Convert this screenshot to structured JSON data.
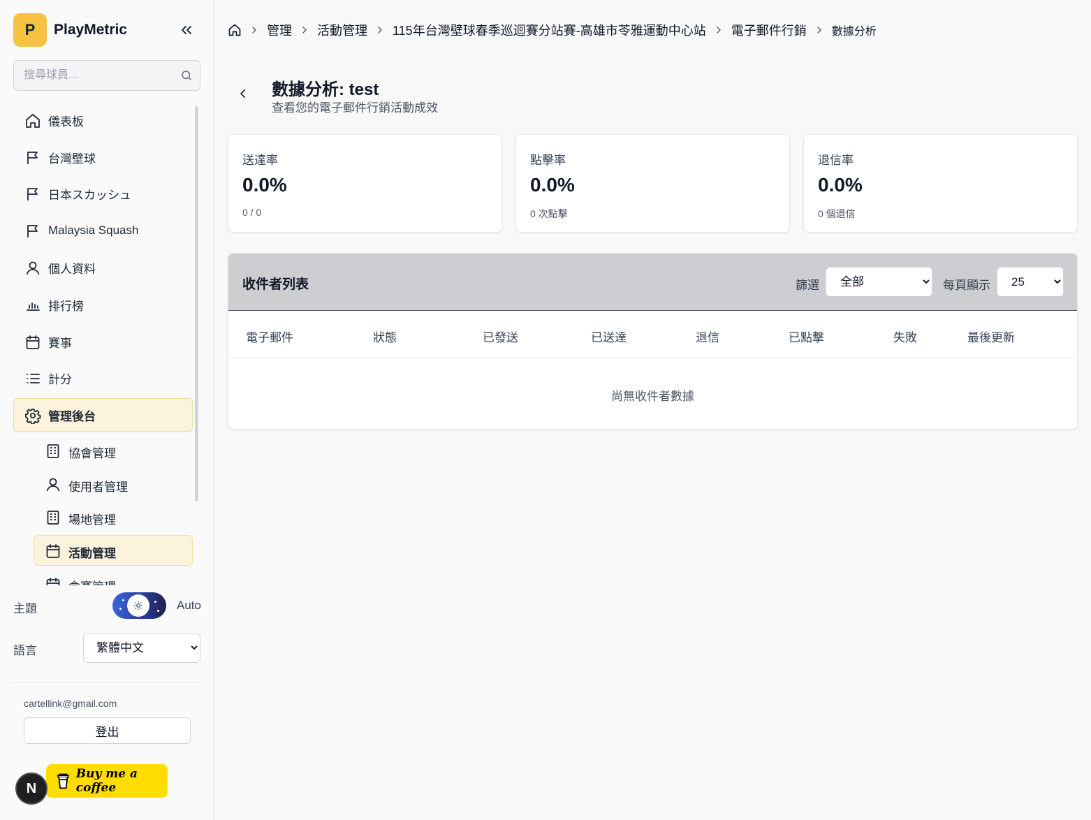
{
  "app": {
    "logo_letter": "P",
    "name": "PlayMetric"
  },
  "search": {
    "placeholder": "搜尋球員..."
  },
  "nav": {
    "items": [
      {
        "label": "儀表板",
        "icon": "home-icon"
      },
      {
        "label": "台灣壁球",
        "icon": "flag-icon"
      },
      {
        "label": "日本スカッシュ",
        "icon": "flag-icon"
      },
      {
        "label": "Malaysia Squash",
        "icon": "flag-icon"
      },
      {
        "label": "個人資料",
        "icon": "user-icon"
      },
      {
        "label": "排行榜",
        "icon": "bar-chart-icon"
      },
      {
        "label": "賽事",
        "icon": "calendar-icon"
      },
      {
        "label": "計分",
        "icon": "list-icon"
      },
      {
        "label": "管理後台",
        "icon": "gear-icon"
      }
    ],
    "sub_items": [
      {
        "label": "協會管理",
        "icon": "building-icon"
      },
      {
        "label": "使用者管理",
        "icon": "user-icon"
      },
      {
        "label": "場地管理",
        "icon": "building-icon"
      },
      {
        "label": "活動管理",
        "icon": "calendar-icon"
      },
      {
        "label": "盒賽管理",
        "icon": "calendar-icon"
      }
    ]
  },
  "theme": {
    "label": "主題",
    "value": "Auto"
  },
  "language": {
    "label": "語言",
    "selected": "繁體中文"
  },
  "user": {
    "email": "cartellink@gmail.com",
    "logout_label": "登出"
  },
  "coffee": {
    "label": "Buy me a coffee"
  },
  "dev_badge": {
    "letter": "N"
  },
  "breadcrumb": [
    "管理",
    "活動管理",
    "115年台灣壁球春季巡迴賽分站賽-高雄市苓雅運動中心站",
    "電子郵件行銷",
    "數據分析"
  ],
  "page": {
    "title": "數據分析: test",
    "subtitle": "查看您的電子郵件行銷活動成效"
  },
  "stats": [
    {
      "label": "送達率",
      "value": "0.0%",
      "sub": "0 / 0"
    },
    {
      "label": "點擊率",
      "value": "0.0%",
      "sub": "0 次點擊"
    },
    {
      "label": "退信率",
      "value": "0.0%",
      "sub": "0 個退信"
    }
  ],
  "recipients": {
    "title": "收件者列表",
    "filter_label": "篩選",
    "filter_selected": "全部",
    "per_page_label": "每頁顯示",
    "per_page_selected": "25",
    "columns": [
      "電子郵件",
      "狀態",
      "已發送",
      "已送達",
      "退信",
      "已點擊",
      "失敗",
      "最後更新"
    ],
    "empty_text": "尚無收件者數據"
  },
  "colors": {
    "accent": "#f5c242",
    "active_bg": "#fcf3dd",
    "coffee": "#ffdd00"
  }
}
